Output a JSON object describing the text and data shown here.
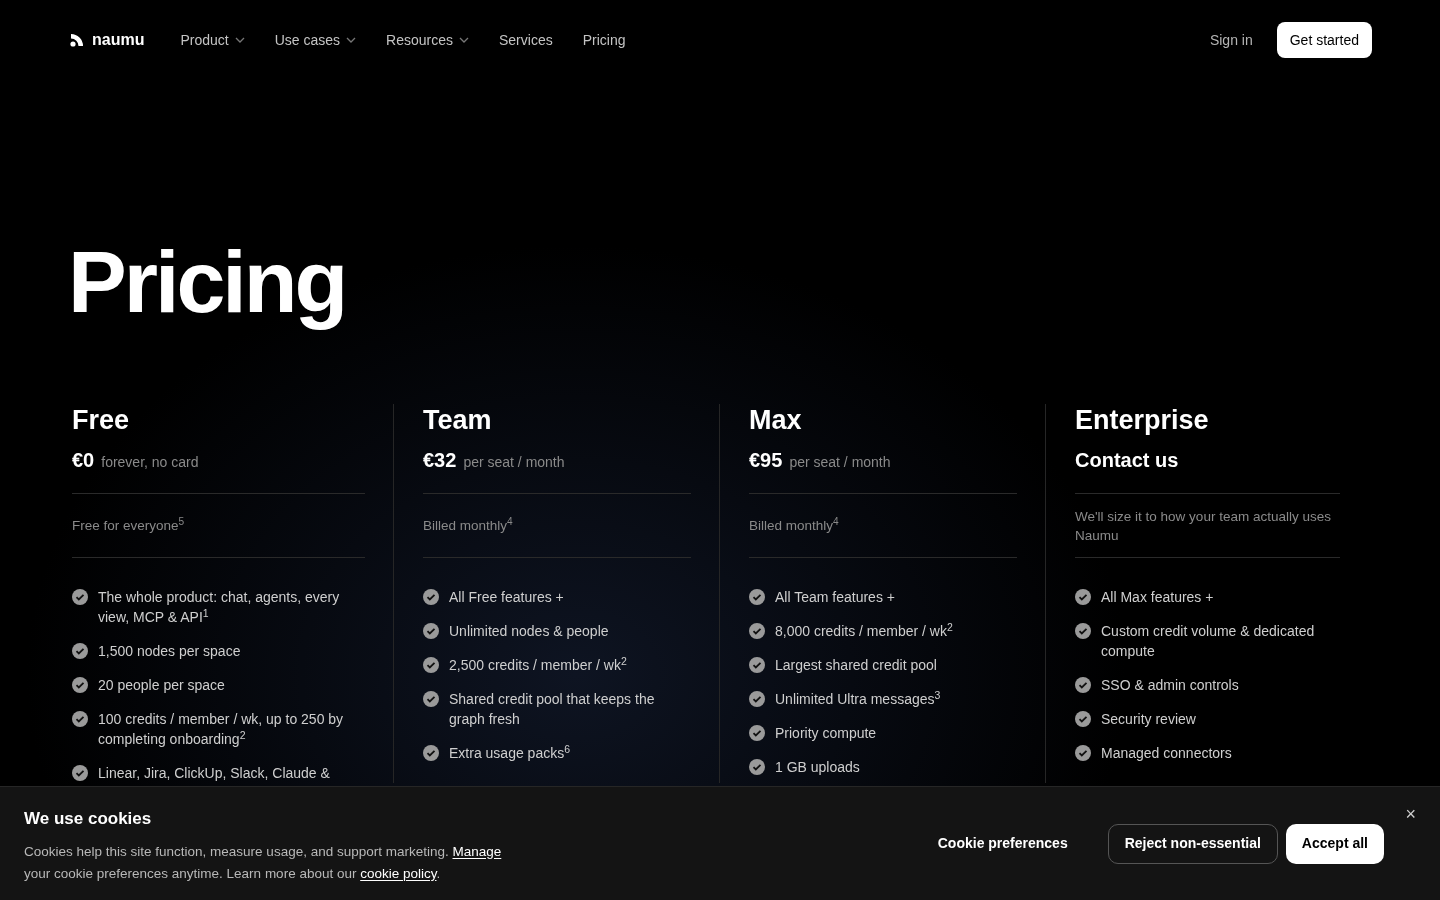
{
  "nav": {
    "logo": "naumu",
    "items": [
      {
        "label": "Product",
        "dropdown": true
      },
      {
        "label": "Use cases",
        "dropdown": true
      },
      {
        "label": "Resources",
        "dropdown": true
      },
      {
        "label": "Services",
        "dropdown": false
      },
      {
        "label": "Pricing",
        "dropdown": false
      }
    ],
    "sign_in": "Sign in",
    "cta": "Get started"
  },
  "heading": "Pricing",
  "plans": [
    {
      "name": "Free",
      "kind": "amount",
      "price": "€0",
      "price_note": "forever, no card",
      "note": "Free for everyone$^{5}$",
      "features": [
        "The whole product: chat, agents, every view, MCP & API$^{1}$",
        "1,500 nodes per space",
        "20 people per space",
        "100 credits / member / wk, up to 250 by completing onboarding$^{2}$",
        "Linear, Jira, ClickUp, Slack, Claude &"
      ]
    },
    {
      "name": "Team",
      "kind": "amount",
      "price": "€32",
      "price_note": "per seat / month",
      "note": "Billed monthly$^{4}$",
      "features": [
        "All Free features +",
        "Unlimited nodes & people",
        "2,500 credits / member / wk$^{2}$",
        "Shared credit pool that keeps the graph fresh",
        "Extra usage packs$^{6}$"
      ]
    },
    {
      "name": "Max",
      "kind": "amount",
      "price": "€95",
      "price_note": "per seat / month",
      "note": "Billed monthly$^{4}$",
      "features": [
        "All Team features +",
        "8,000 credits / member / wk$^{2}$",
        "Largest shared credit pool",
        "Unlimited Ultra messages$^{3}$",
        "Priority compute",
        "1 GB uploads"
      ]
    },
    {
      "name": "Enterprise",
      "kind": "contact",
      "price": "Contact us",
      "note": "We'll size it to how your team actually uses Naumu",
      "features": [
        "All Max features +",
        "Custom credit volume & dedicated compute",
        "SSO & admin controls",
        "Security review",
        "Managed connectors"
      ]
    }
  ],
  "cookie_banner": {
    "title": "We use cookies",
    "text": [
      {
        "kind": "text",
        "text": "Cookies help this site function, measure usage, and support marketing. "
      },
      {
        "kind": "link",
        "text": "Manage"
      },
      {
        "kind": "text",
        "text": " your cookie preferences anytime. Learn more about our "
      },
      {
        "kind": "link",
        "text": "cookie policy"
      },
      {
        "kind": "text",
        "text": "."
      }
    ],
    "buttons": [
      {
        "label": "Cookie preferences",
        "kind": "plain"
      },
      {
        "label": "Reject non-essential",
        "kind": "outline"
      },
      {
        "label": "Accept all",
        "kind": "filled"
      }
    ],
    "close": "×"
  }
}
